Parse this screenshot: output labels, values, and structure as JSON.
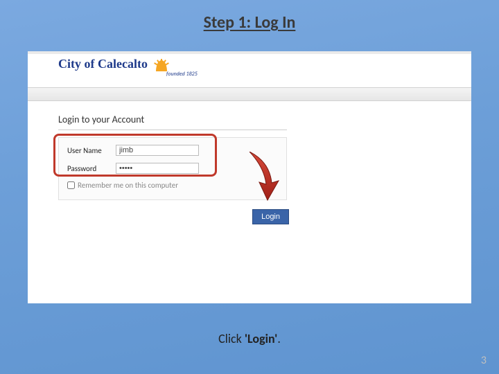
{
  "slide": {
    "title": "Step 1: Log In",
    "caption_prefix": "Click ",
    "caption_bold": "'Login'",
    "caption_suffix": ".",
    "page_number": "3"
  },
  "brand": {
    "name": "City of Calecalto",
    "founded": "founded 1825"
  },
  "login": {
    "panel_heading": "Login to your Account",
    "username_label": "User Name",
    "username_value": "jimb",
    "password_label": "Password",
    "password_value": "•••••",
    "remember_label": "Remember me on this computer",
    "login_button": "Login"
  }
}
